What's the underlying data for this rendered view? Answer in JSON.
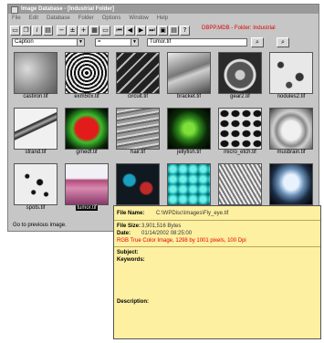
{
  "window": {
    "title": "Image Database - [Industrial Folder]"
  },
  "menu": [
    "File",
    "Edit",
    "Database",
    "Folder",
    "Options",
    "Window",
    "Help"
  ],
  "folder_path": "DBPP.MDB - Folder: Industrial",
  "filter": {
    "field": "Caption",
    "operator": "=",
    "value": "Tumor.tif"
  },
  "thumbnails": [
    {
      "caption": "castiron.tif"
    },
    {
      "caption": "exm50x.tif"
    },
    {
      "caption": "circuit.tif"
    },
    {
      "caption": "bracket.tif"
    },
    {
      "caption": "gear2.tif"
    },
    {
      "caption": "nodules2.tif"
    },
    {
      "caption": "strand.tif"
    },
    {
      "caption": "grnedf.tif"
    },
    {
      "caption": "hair.tif"
    },
    {
      "caption": "jellyfish.tif"
    },
    {
      "caption": "micro_etch.tif"
    },
    {
      "caption": "musbrain.tif"
    },
    {
      "caption": "spots.tif"
    },
    {
      "caption": "tumor.tif"
    },
    {
      "caption": ""
    },
    {
      "caption": ""
    },
    {
      "caption": ""
    },
    {
      "caption": ""
    }
  ],
  "status": "Go to previous image.",
  "info": {
    "file_name_label": "File Name:",
    "file_name": "C:\\WPDisc\\Images\\Fly_eye.tif",
    "file_size_label": "File Size:",
    "file_size": "3,901,516 Bytes",
    "date_label": "Date:",
    "date": "01/14/2002 08:25:00",
    "image_desc": "RGB True Color Image, 1298 by 1001 pixels, 100 Dpi",
    "subject_label": "Subject:",
    "keywords_label": "Keywords:",
    "description_label": "Description:"
  },
  "colors": {
    "accent_red": "#e00000",
    "info_panel": "#fdf0a1"
  }
}
